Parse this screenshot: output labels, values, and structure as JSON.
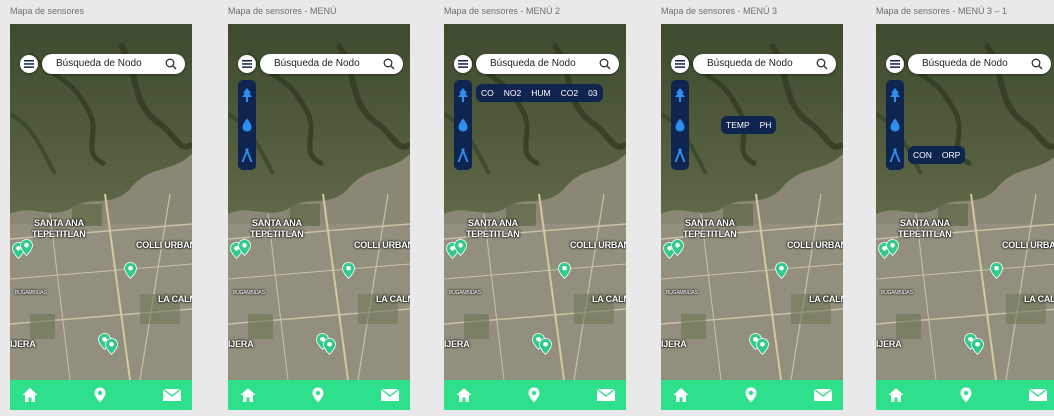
{
  "frames": [
    {
      "title": "Mapa de sensores",
      "menu_open": false,
      "pill": []
    },
    {
      "title": "Mapa de sensores - MENÚ",
      "menu_open": true,
      "pill": []
    },
    {
      "title": "Mapa de sensores - MENÚ 2",
      "menu_open": true,
      "pill": [
        "CO",
        "NO2",
        "HUM",
        "CO2",
        "03"
      ]
    },
    {
      "title": "Mapa de sensores - MENÚ 3",
      "menu_open": true,
      "pill": [
        "TEMP",
        "PH"
      ]
    },
    {
      "title": "Mapa de sensores - MENÚ 3 – 1",
      "menu_open": true,
      "pill": [
        "CON",
        "ORP"
      ]
    }
  ],
  "search": {
    "placeholder": "Búsqueda de Nodo",
    "icon": "search-icon"
  },
  "map_labels": {
    "santa_ana": "SANTA ANA",
    "tepetitlan": "TEPETITLAN",
    "colli_urban": "COLLI URBAN",
    "bugambilias": "BUGAMBILIAS",
    "la_calma": "LA CALMA",
    "ijera": "IJERA"
  },
  "side_menu": [
    "tree-icon",
    "water-drop-icon",
    "tower-icon"
  ],
  "bottom_nav": [
    "home-icon",
    "location-pin-icon",
    "mail-icon"
  ],
  "colors": {
    "nav_green": "#2ee08c",
    "panel_navy": "#0f2550",
    "marker_green": "#33c98a"
  }
}
